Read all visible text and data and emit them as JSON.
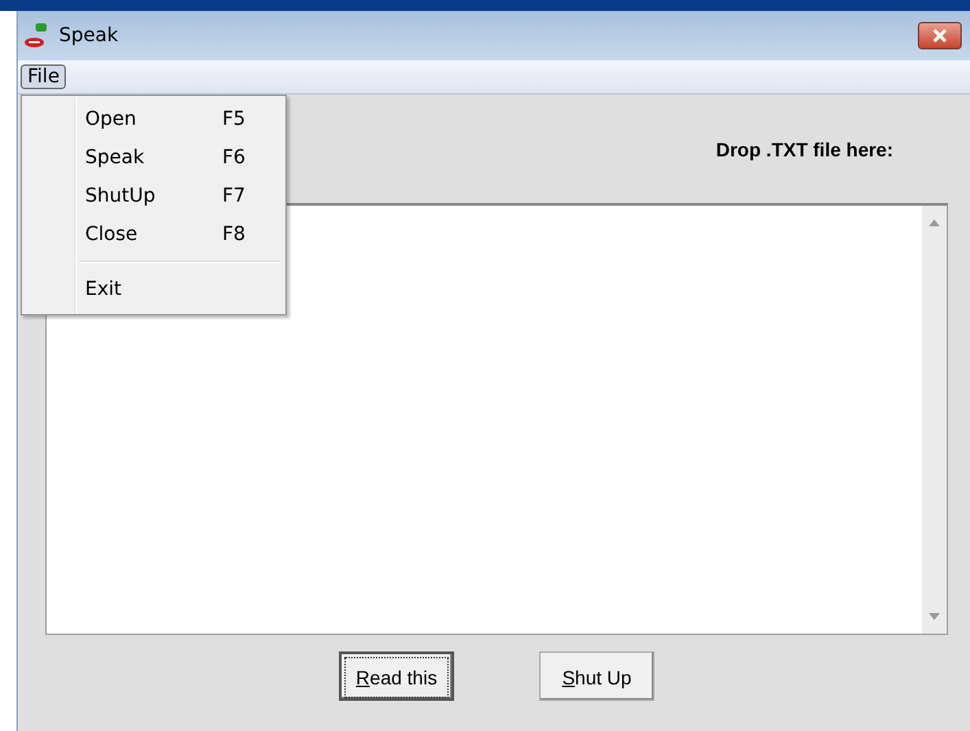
{
  "window": {
    "title": "Speak"
  },
  "menu_bar": [
    {
      "label": "File",
      "selected": true
    }
  ],
  "file_menu": {
    "items": [
      {
        "kind": "item",
        "label": "Open",
        "shortcut": "F5"
      },
      {
        "kind": "item",
        "label": "Speak",
        "shortcut": "F6"
      },
      {
        "kind": "item",
        "label": "ShutUp",
        "shortcut": "F7"
      },
      {
        "kind": "item",
        "label": "Close",
        "shortcut": "F8"
      },
      {
        "kind": "separator"
      },
      {
        "kind": "item",
        "label": "Exit"
      }
    ]
  },
  "drop_label": "Drop .TXT file here:",
  "buttons": [
    {
      "label": "Read this",
      "focused": true
    },
    {
      "label": "Shut Up",
      "focused": false
    }
  ]
}
